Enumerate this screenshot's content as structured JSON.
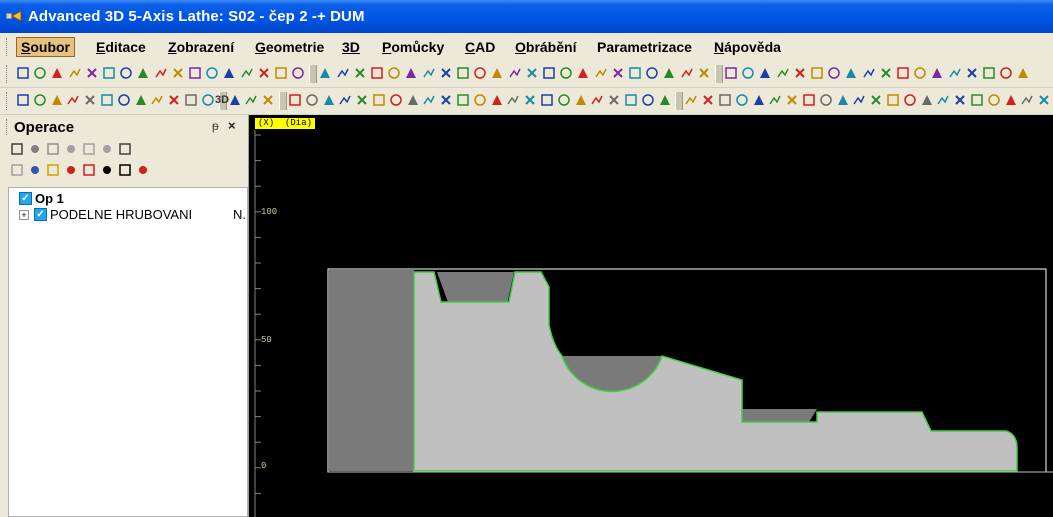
{
  "window": {
    "title": "Advanced 3D 5-Axis Lathe: S02 - čep 2 -+ DUM",
    "title_bar_color": "#0054e3"
  },
  "menu": {
    "items": [
      {
        "mnemonic": "S",
        "rest": "oubor",
        "active": true
      },
      {
        "mnemonic": "E",
        "rest": "ditace",
        "active": false
      },
      {
        "mnemonic": "Z",
        "rest": "obrazení",
        "active": false
      },
      {
        "mnemonic": "G",
        "rest": "eometrie",
        "active": false
      },
      {
        "mnemonic": "3D",
        "rest": "",
        "active": false
      },
      {
        "mnemonic": "P",
        "rest": "omůcky",
        "active": false
      },
      {
        "mnemonic": "C",
        "rest": "AD",
        "active": false
      },
      {
        "mnemonic": "O",
        "rest": "brábění",
        "active": false
      },
      {
        "mnemonic": "",
        "rest": "Parametrizace",
        "active": false
      },
      {
        "mnemonic": "N",
        "rest": "ápověda",
        "active": false
      }
    ]
  },
  "toolbar2": {
    "label_3d": "3D"
  },
  "panel": {
    "title": "Operace",
    "pin_glyph": "ᵽ",
    "close_glyph": "×",
    "tree": {
      "op_label": "Op 1",
      "child_label": "PODELNE HRUBOVANI",
      "child_suffix": "N."
    }
  },
  "canvas": {
    "axis_tag": "(X)  (Dia)",
    "y_labels": [
      "100",
      "50",
      "0"
    ],
    "colors": {
      "background": "#000000",
      "part": "#c0c0c0",
      "removed": "#7a7a7a",
      "contour": "#3fd040",
      "stock_outline": "#ffffff",
      "axis_tag_bg": "#ffff00"
    }
  }
}
